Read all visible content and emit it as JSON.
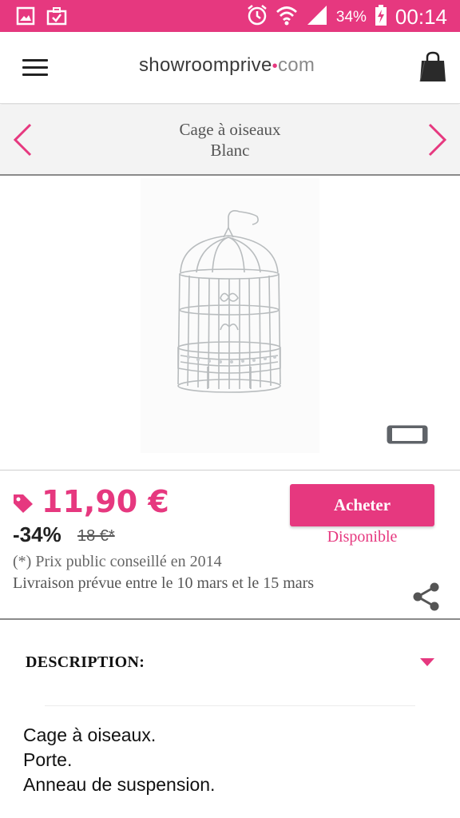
{
  "status_bar": {
    "battery_percent": "34%",
    "time": "00:14",
    "icons": [
      "gallery-icon",
      "briefcase-check-icon",
      "alarm-icon",
      "wifi-icon",
      "signal-icon",
      "battery-charging-icon"
    ]
  },
  "header": {
    "logo_part1": "showroomprive",
    "logo_dot": "•",
    "logo_part2": "com",
    "menu_icon": "hamburger-icon",
    "cart_icon": "shopping-bag-icon"
  },
  "product": {
    "title_line1": "Cage à oiseaux",
    "title_line2": "Blanc"
  },
  "pricing": {
    "price": "11,90 €",
    "discount": "-34%",
    "old_price": "18 €*",
    "note": "(*) Prix public conseillé en 2014",
    "delivery": "Livraison prévue entre le 10 mars et le 15 mars",
    "buy_label": "Acheter",
    "availability": "Disponible"
  },
  "description": {
    "title": "DESCRIPTION:",
    "lines": [
      "Cage à oiseaux.",
      "Porte.",
      "Anneau de suspension."
    ]
  },
  "colors": {
    "accent": "#e6387f",
    "nav_bg": "#f3f3f3"
  }
}
